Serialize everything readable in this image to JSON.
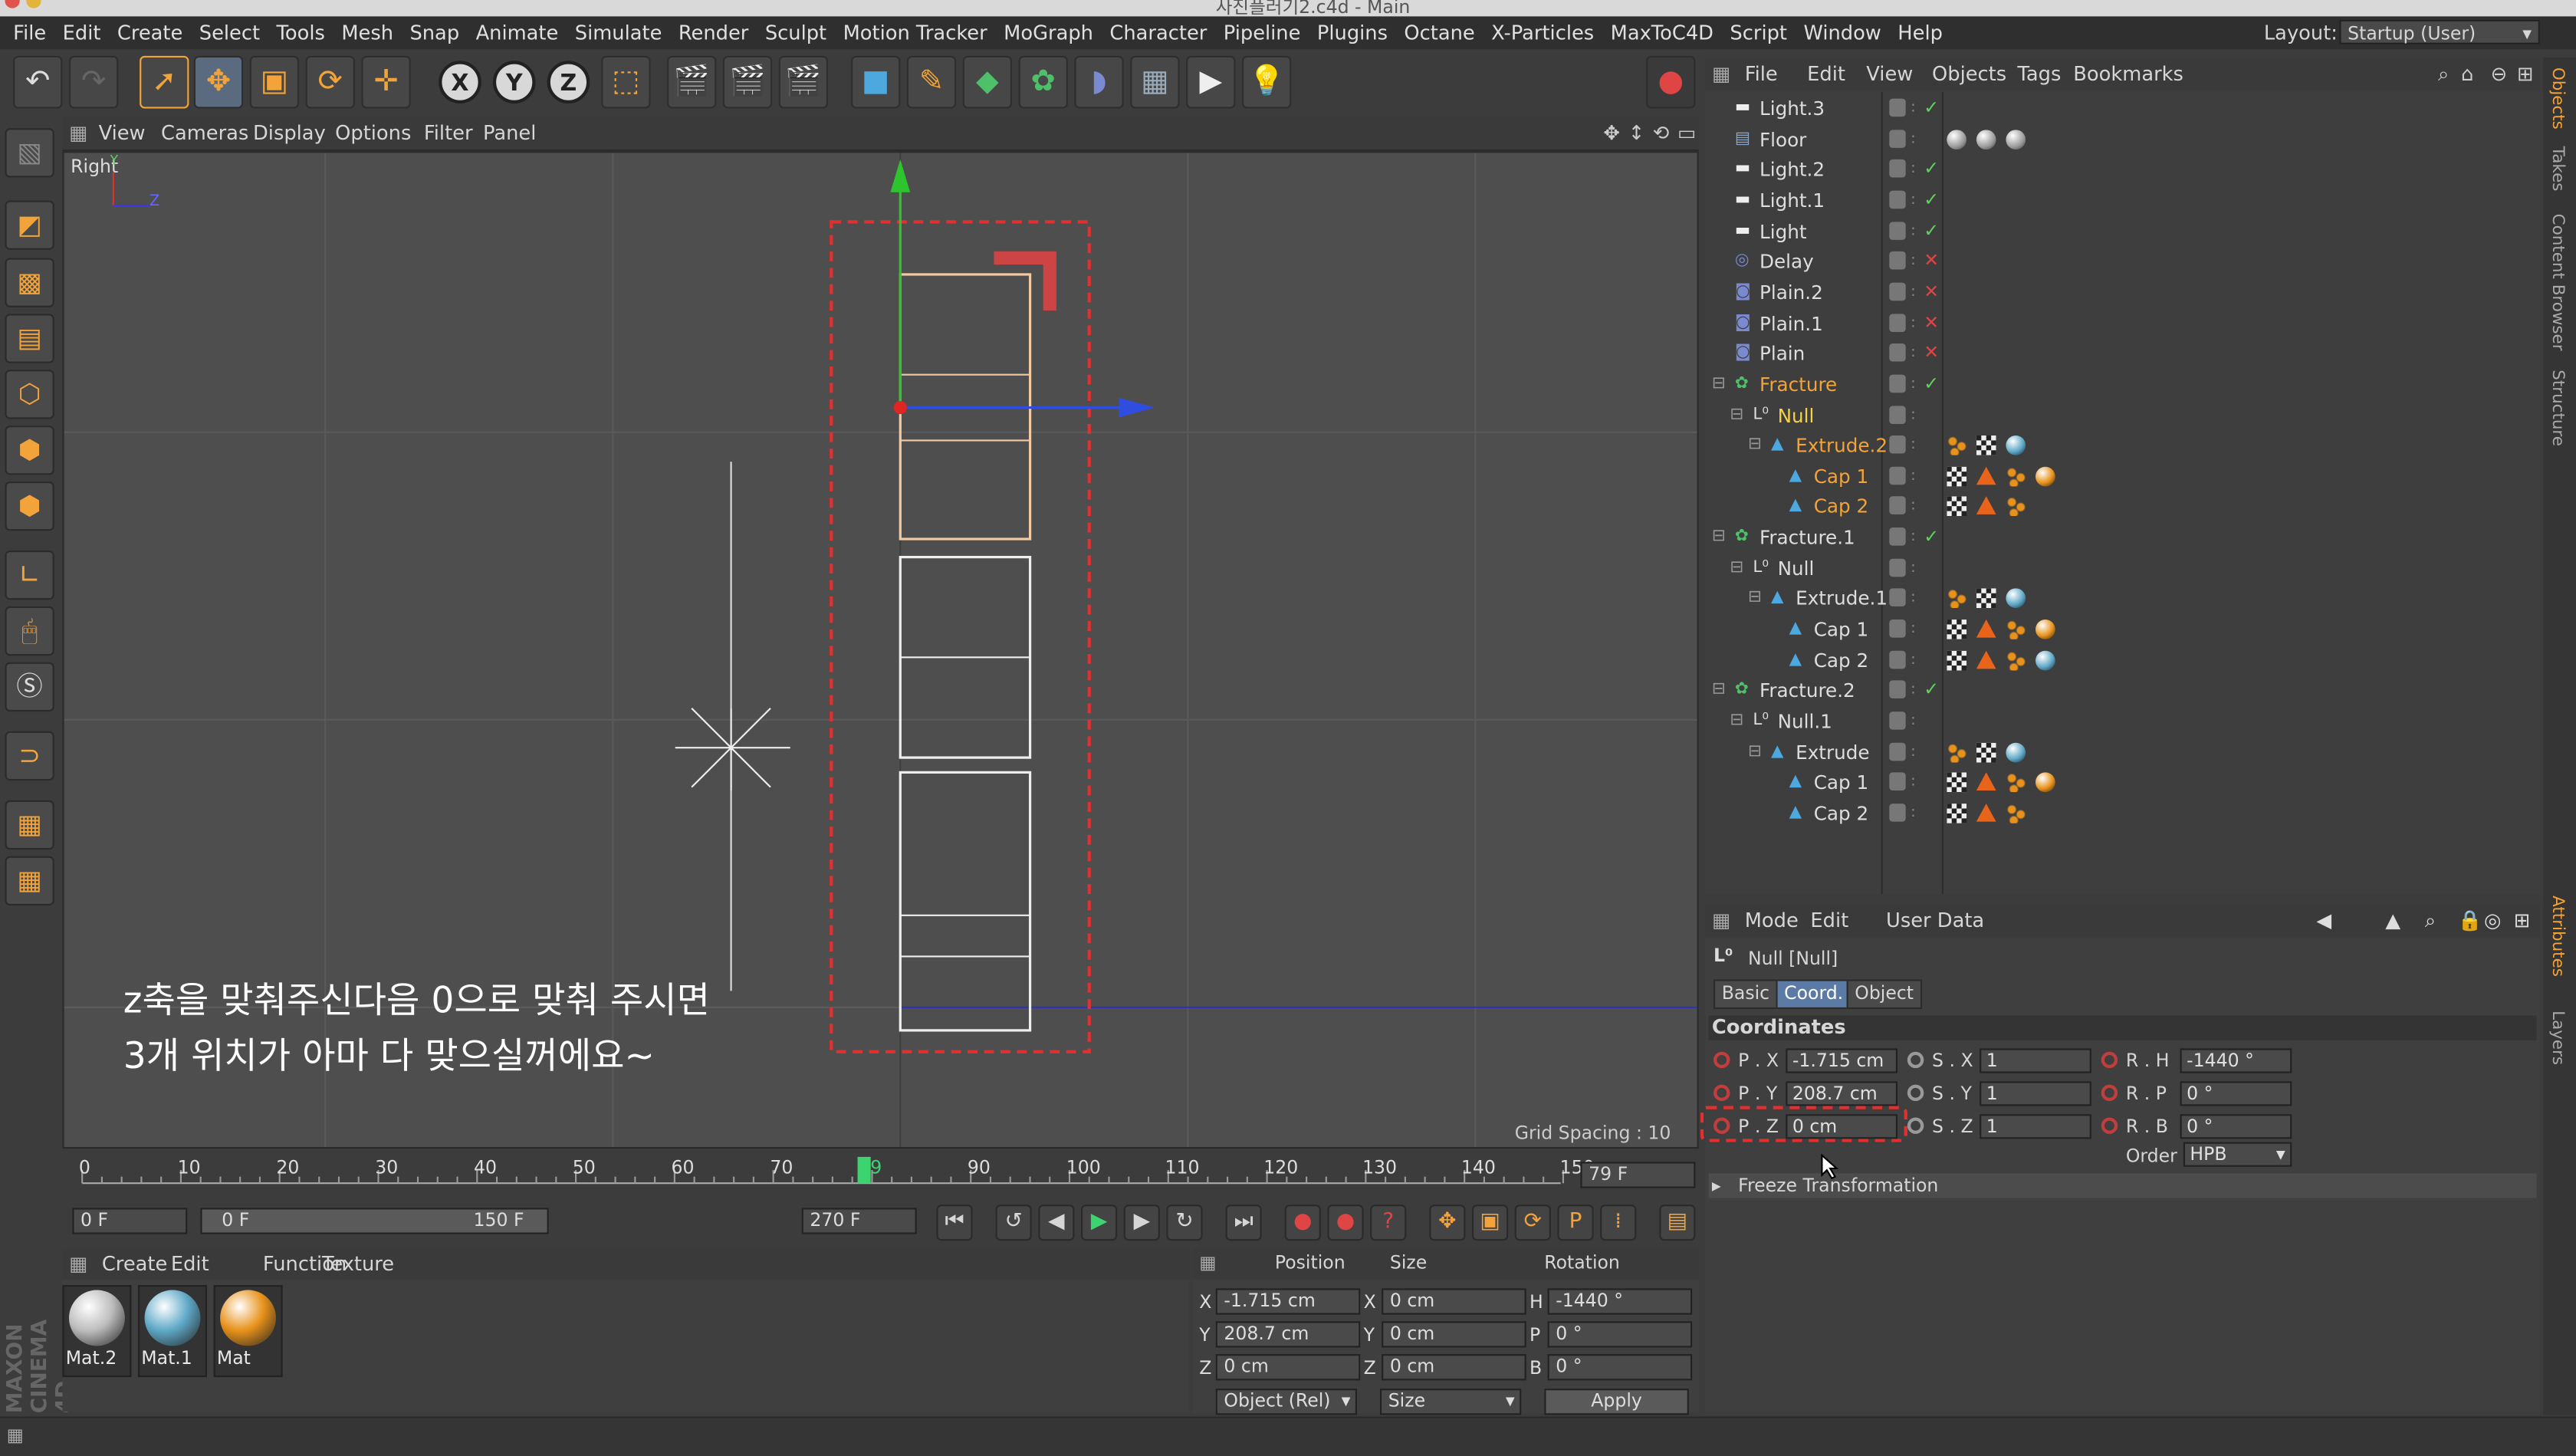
{
  "window": {
    "title": "사진플러기2.c4d - Main"
  },
  "menu": [
    "File",
    "Edit",
    "Create",
    "Select",
    "Tools",
    "Mesh",
    "Snap",
    "Animate",
    "Simulate",
    "Render",
    "Sculpt",
    "Motion Tracker",
    "MoGraph",
    "Character",
    "Pipeline",
    "Plugins",
    "Octane",
    "X-Particles",
    "MaxToC4D",
    "Script",
    "Window",
    "Help"
  ],
  "layout": {
    "label": "Layout:",
    "value": "Startup (User)"
  },
  "viewport": {
    "menu": [
      "View",
      "Cameras",
      "Display",
      "Options",
      "Filter",
      "Panel"
    ],
    "view_name": "Right",
    "axis_y": "Y",
    "axis_z": "Z",
    "grid_spacing": "Grid Spacing : 10 cm",
    "caption": "z축을 맞춰주신다음 0으로 맞춰 주시면\n3개 위치가 아마 다 맞으실꺼에요~"
  },
  "timeline": {
    "ticks": [
      "0",
      "10",
      "20",
      "30",
      "40",
      "50",
      "60",
      "70",
      "79",
      "90",
      "100",
      "110",
      "120",
      "130",
      "140",
      "150"
    ],
    "current_frame": "79 F",
    "start_field": "0 F",
    "range_start": "0 F",
    "range_end": "150 F",
    "end_field": "270 F"
  },
  "materials": {
    "menu": [
      "Create",
      "Edit",
      "Function",
      "Texture"
    ],
    "items": [
      {
        "name": "Mat.2",
        "color": "#bdbdbd"
      },
      {
        "name": "Mat.1",
        "color": "#5fa9c8"
      },
      {
        "name": "Mat",
        "color": "#e8921a"
      }
    ]
  },
  "coord_manager": {
    "headers": [
      "Position",
      "Size",
      "Rotation"
    ],
    "rows": [
      {
        "axis": "X",
        "pos": "-1.715 cm",
        "size_axis": "X",
        "size": "0 cm",
        "rot_axis": "H",
        "rot": "-1440 °"
      },
      {
        "axis": "Y",
        "pos": "208.7 cm",
        "size_axis": "Y",
        "size": "0 cm",
        "rot_axis": "P",
        "rot": "0 °"
      },
      {
        "axis": "Z",
        "pos": "0 cm",
        "size_axis": "Z",
        "size": "0 cm",
        "rot_axis": "B",
        "rot": "0 °"
      }
    ],
    "mode": "Object (Rel)",
    "size_mode": "Size",
    "apply": "Apply"
  },
  "object_manager": {
    "menu": [
      "File",
      "Edit",
      "View",
      "Objects",
      "Tags",
      "Bookmarks"
    ],
    "objects": [
      {
        "name": "Light.3",
        "indent": 0,
        "status": "✓",
        "status_color": "#5fd35f",
        "highlight": false,
        "tags": []
      },
      {
        "name": "Floor",
        "indent": 0,
        "status": "",
        "status_color": "#5fd35f",
        "highlight": false,
        "tags": [
          "grey",
          "grey",
          "grey"
        ]
      },
      {
        "name": "Light.2",
        "indent": 0,
        "status": "✓",
        "status_color": "#5fd35f",
        "highlight": false,
        "tags": []
      },
      {
        "name": "Light.1",
        "indent": 0,
        "status": "✓",
        "status_color": "#5fd35f",
        "highlight": false,
        "tags": []
      },
      {
        "name": "Light",
        "indent": 0,
        "status": "✓",
        "status_color": "#5fd35f",
        "highlight": false,
        "tags": []
      },
      {
        "name": "Delay",
        "indent": 0,
        "status": "✕",
        "status_color": "#e04545",
        "highlight": false,
        "tags": []
      },
      {
        "name": "Plain.2",
        "indent": 0,
        "status": "✕",
        "status_color": "#e04545",
        "highlight": false,
        "tags": []
      },
      {
        "name": "Plain.1",
        "indent": 0,
        "status": "✕",
        "status_color": "#e04545",
        "highlight": false,
        "tags": []
      },
      {
        "name": "Plain",
        "indent": 0,
        "status": "✕",
        "status_color": "#e04545",
        "highlight": false,
        "tags": []
      },
      {
        "name": "Fracture",
        "indent": 0,
        "status": "✓",
        "status_color": "#5fd35f",
        "highlight": true,
        "tags": []
      },
      {
        "name": "Null",
        "indent": 1,
        "status": "",
        "status_color": "#5fd35f",
        "highlight": "yellow",
        "tags": []
      },
      {
        "name": "Extrude.2",
        "indent": 2,
        "status": "",
        "status_color": "#5fd35f",
        "highlight": true,
        "tags": [
          "dots",
          "checker",
          "blue"
        ]
      },
      {
        "name": "Cap 1",
        "indent": 3,
        "status": "",
        "status_color": "#5fd35f",
        "highlight": true,
        "tags": [
          "checker",
          "tri",
          "dots",
          "orange"
        ]
      },
      {
        "name": "Cap 2",
        "indent": 3,
        "status": "",
        "status_color": "#5fd35f",
        "highlight": true,
        "tags": [
          "checker",
          "tri",
          "dots"
        ]
      },
      {
        "name": "Fracture.1",
        "indent": 0,
        "status": "✓",
        "status_color": "#5fd35f",
        "highlight": false,
        "tags": []
      },
      {
        "name": "Null",
        "indent": 1,
        "status": "",
        "status_color": "#5fd35f",
        "highlight": false,
        "tags": []
      },
      {
        "name": "Extrude.1",
        "indent": 2,
        "status": "",
        "status_color": "#5fd35f",
        "highlight": false,
        "tags": [
          "dots",
          "checker",
          "blue"
        ]
      },
      {
        "name": "Cap 1",
        "indent": 3,
        "status": "",
        "status_color": "#5fd35f",
        "highlight": false,
        "tags": [
          "checker",
          "tri",
          "dots",
          "orange"
        ]
      },
      {
        "name": "Cap 2",
        "indent": 3,
        "status": "",
        "status_color": "#5fd35f",
        "highlight": false,
        "tags": [
          "checker",
          "tri",
          "dots",
          "blue"
        ]
      },
      {
        "name": "Fracture.2",
        "indent": 0,
        "status": "✓",
        "status_color": "#5fd35f",
        "highlight": false,
        "tags": []
      },
      {
        "name": "Null.1",
        "indent": 1,
        "status": "",
        "status_color": "#5fd35f",
        "highlight": false,
        "tags": []
      },
      {
        "name": "Extrude",
        "indent": 2,
        "status": "",
        "status_color": "#5fd35f",
        "highlight": false,
        "tags": [
          "dots",
          "checker",
          "blue"
        ]
      },
      {
        "name": "Cap 1",
        "indent": 3,
        "status": "",
        "status_color": "#5fd35f",
        "highlight": false,
        "tags": [
          "checker",
          "tri",
          "dots",
          "orange"
        ]
      },
      {
        "name": "Cap 2",
        "indent": 3,
        "status": "",
        "status_color": "#5fd35f",
        "highlight": false,
        "tags": [
          "checker",
          "tri",
          "dots"
        ]
      }
    ]
  },
  "attributes": {
    "menu": [
      "Mode",
      "Edit",
      "User Data"
    ],
    "object_title": "Null [Null]",
    "tabs": [
      "Basic",
      "Coord.",
      "Object"
    ],
    "active_tab": "Coord.",
    "section": "Coordinates",
    "rows": [
      {
        "p_label": "P . X",
        "p_val": "-1.715 cm",
        "s_label": "S . X",
        "s_val": "1",
        "r_label": "R . H",
        "r_val": "-1440 °"
      },
      {
        "p_label": "P . Y",
        "p_val": "208.7 cm",
        "s_label": "S . Y",
        "s_val": "1",
        "r_label": "R . P",
        "r_val": "0 °"
      },
      {
        "p_label": "P . Z",
        "p_val": "0 cm",
        "s_label": "S . Z",
        "s_val": "1",
        "r_label": "R . B",
        "r_val": "0 °"
      }
    ],
    "order_label": "Order",
    "order_value": "HPB",
    "freeze": "Freeze Transformation"
  },
  "side_tabs": [
    "Objects",
    "Takes",
    "Content Browser",
    "Structure",
    "Attributes",
    "Layers"
  ],
  "brand": "MAXON CINEMA 4D",
  "colors": {
    "accent": "#f2a33a",
    "selected_text": "#f2a33a",
    "null_yellow": "#f5d04a",
    "highlight_dash": "#e03030"
  }
}
